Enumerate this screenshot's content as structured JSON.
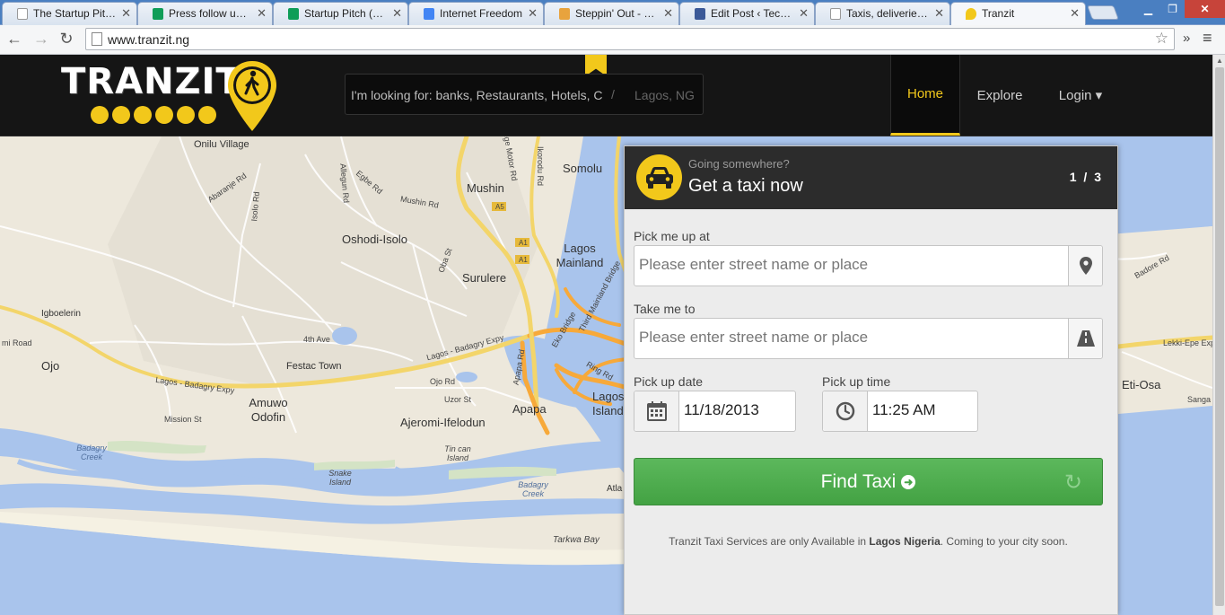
{
  "browser": {
    "tabs": [
      {
        "title": "The Startup Pitch |",
        "color": "#ffffff"
      },
      {
        "title": "Press follow up fo",
        "color": "#0f9d58"
      },
      {
        "title": "Startup Pitch (Resp",
        "color": "#0f9d58"
      },
      {
        "title": "Internet Freedom",
        "color": "#4285f4"
      },
      {
        "title": "Steppin' Out - Joe",
        "color": "#e8a33d"
      },
      {
        "title": "Edit Post ‹ TechCa",
        "color": "#3b5998"
      },
      {
        "title": "Taxis, deliveries an",
        "color": "#ffffff"
      },
      {
        "title": "Tranzit",
        "color": "#f2c81b"
      }
    ],
    "active_tab": 7,
    "url": "www.tranzit.ng",
    "icons": {
      "back": "back-arrow-icon",
      "forward": "forward-arrow-icon",
      "reload": "reload-icon",
      "bookmark": "star-icon",
      "menu": "hamburger-menu-icon"
    }
  },
  "header": {
    "logo_text": "TRANZIT",
    "search_placeholder": "I'm looking for: banks, Restaurants, Hotels, C",
    "search_separator": "/",
    "location_placeholder": "Lagos, NG",
    "nav": [
      {
        "label": "Home",
        "active": true
      },
      {
        "label": "Explore",
        "active": false
      },
      {
        "label": "Login ▾",
        "active": false
      }
    ],
    "accent_color": "#f2c81b"
  },
  "map": {
    "labels": [
      "Onilu Village",
      "Somolu",
      "Mushin",
      "Oshodi-Isolo",
      "Lagos Mainland",
      "Surulere",
      "Igboelerin",
      "Ojo",
      "Festac Town",
      "Amuwo Odofin",
      "Ajeromi-Ifelodun",
      "Apapa",
      "Lagos Island",
      "Mission St",
      "Badagry Creek",
      "Tin can Island",
      "Snake Island",
      "Badagry Creek",
      "Tarkwa Bay",
      "Eti-Osa",
      "Lekki-Epe Expy",
      "Lagos - Badagry Expy",
      "Lagos - Badagry Expy",
      "Eko Bridge",
      "Apapa Rd",
      "Third Mainland Bridge",
      "Ikorodu Rd",
      "4th Ave",
      "Ojo Rd",
      "Uzor St",
      "Oba St",
      "Abaranje Rd",
      "Agege Motor Rd",
      "Mushin Rd",
      "Egbe Rd",
      "Isolo Rd",
      "Allegun Rd",
      "mi Road",
      "Ring Rd",
      "A5",
      "A1",
      "A1",
      "Atla",
      "Badore Rd",
      "Sanga"
    ]
  },
  "booking": {
    "subtitle": "Going somewhere?",
    "title": "Get a taxi now",
    "step": "1 / 3",
    "pickup_label": "Pick me up at",
    "pickup_placeholder": "Please enter street name or place",
    "dropoff_label": "Take me to",
    "dropoff_placeholder": "Please enter street name or place",
    "date_label": "Pick up date",
    "date_value": "11/18/2013",
    "time_label": "Pick up time",
    "time_value": "11:25 AM",
    "button_label": "Find Taxi",
    "note_prefix": "Tranzit Taxi Services are only Available in",
    "note_city": "Lagos Nigeria",
    "note_suffix": ". Coming to your city soon.",
    "icons": {
      "badge": "taxi-icon",
      "pickup": "map-marker-icon",
      "dropoff": "road-icon",
      "date": "calendar-icon",
      "time": "clock-icon",
      "button": "arrow-circle-right-icon",
      "refresh": "refresh-icon"
    },
    "button_color": "#5cb85c"
  }
}
